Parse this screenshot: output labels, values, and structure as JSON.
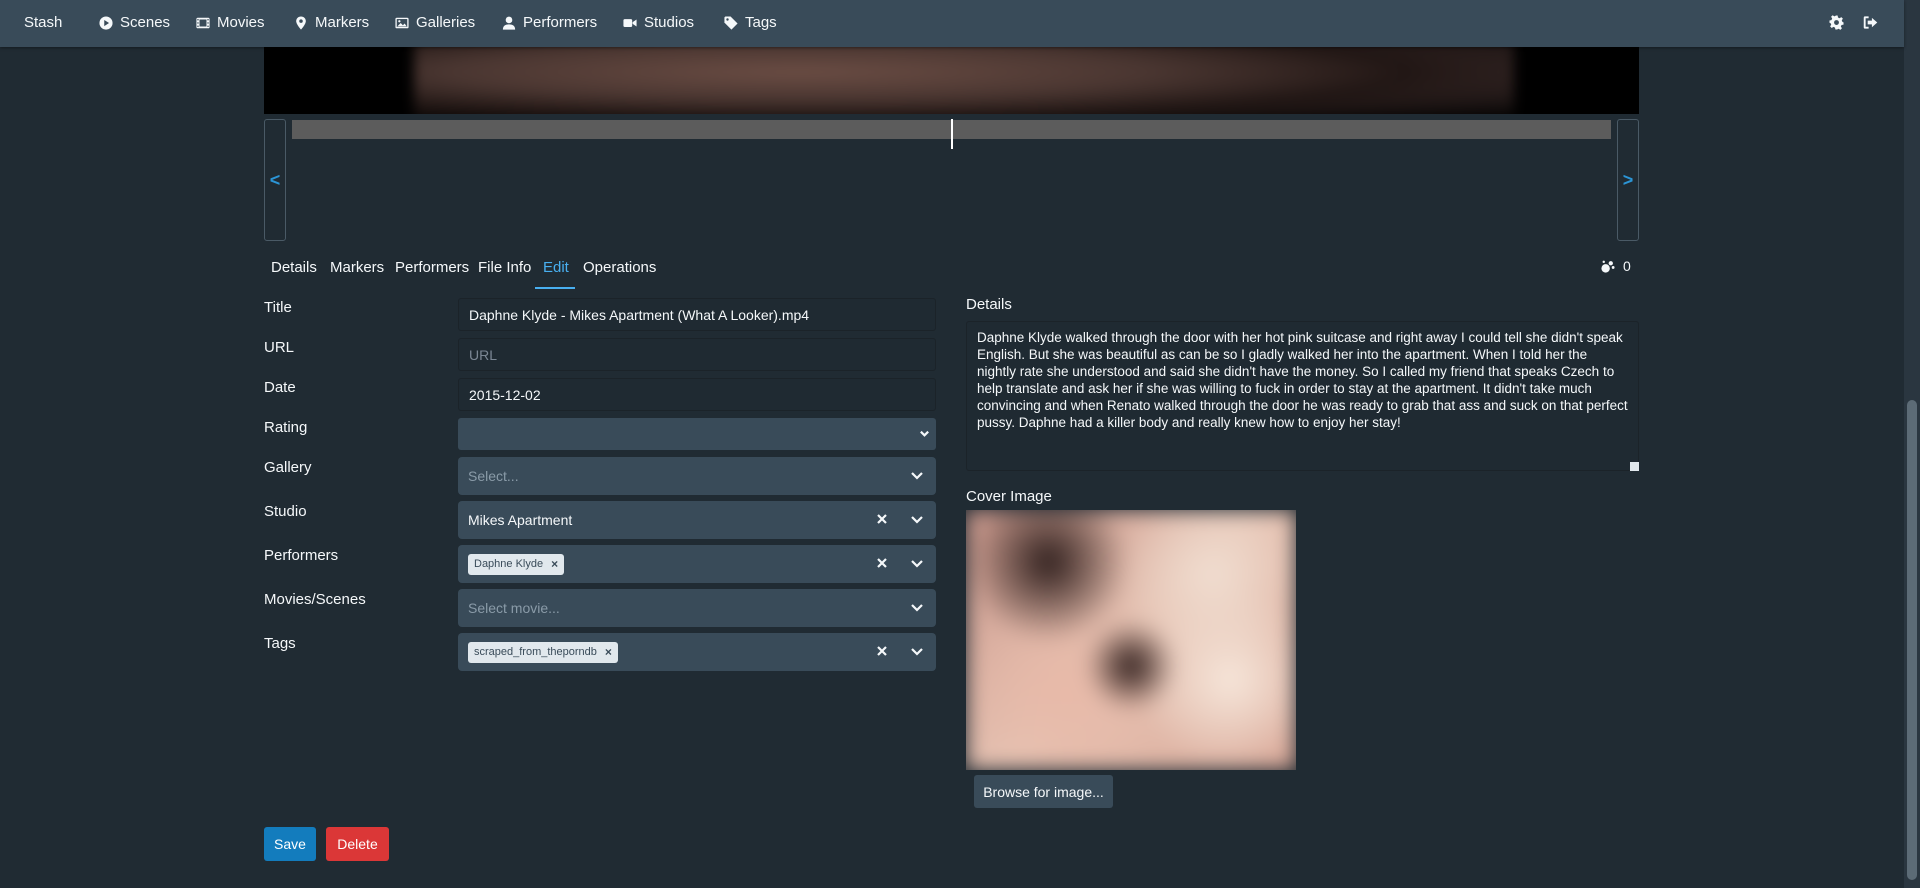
{
  "nav": {
    "brand": "Stash",
    "items": [
      {
        "label": "Scenes",
        "icon": "play-circle-icon"
      },
      {
        "label": "Movies",
        "icon": "film-icon"
      },
      {
        "label": "Markers",
        "icon": "map-marker-icon"
      },
      {
        "label": "Galleries",
        "icon": "image-icon"
      },
      {
        "label": "Performers",
        "icon": "user-icon"
      },
      {
        "label": "Studios",
        "icon": "video-icon"
      },
      {
        "label": "Tags",
        "icon": "tag-icon"
      }
    ],
    "right_icons": [
      "gear-icon",
      "sign-out-icon"
    ]
  },
  "scrubber": {
    "prev_label": "<",
    "next_label": ">",
    "position_fraction": 0.41
  },
  "tabs": {
    "items": [
      "Details",
      "Markers",
      "Performers",
      "File Info",
      "Edit",
      "Operations"
    ],
    "active": "Edit",
    "o_counter": "0"
  },
  "form": {
    "title_label": "Title",
    "title_value": "Daphne Klyde - Mikes Apartment (What A Looker).mp4",
    "url_label": "URL",
    "url_placeholder": "URL",
    "date_label": "Date",
    "date_value": "2015-12-02",
    "rating_label": "Rating",
    "gallery_label": "Gallery",
    "gallery_placeholder": "Select...",
    "studio_label": "Studio",
    "studio_value": "Mikes Apartment",
    "performers_label": "Performers",
    "performers": [
      "Daphne Klyde"
    ],
    "movies_label": "Movies/Scenes",
    "movies_placeholder": "Select movie...",
    "tags_label": "Tags",
    "tags": [
      "scraped_from_theporndb"
    ]
  },
  "details": {
    "label": "Details",
    "text": "Daphne Klyde walked through the door with her hot pink suitcase and right away I could tell she didn't speak English. But she was beautiful as can be so I gladly walked her into the apartment. When I told her the nightly rate she understood and said she didn't have the money. So I called my friend that speaks Czech to help translate and ask her if she was willing to fuck in order to stay at the apartment. It didn't take much convincing and when Renato walked through the door he was ready to grab that ass and suck on that perfect pussy. Daphne had a killer body and really knew how to enjoy her stay!"
  },
  "cover": {
    "label": "Cover Image",
    "browse_label": "Browse for image..."
  },
  "actions": {
    "save_label": "Save",
    "delete_label": "Delete"
  },
  "colors": {
    "background": "#202b33",
    "navbar": "#394b59",
    "accent": "#48aff0",
    "save": "#137cbd",
    "delete": "#db3737"
  }
}
